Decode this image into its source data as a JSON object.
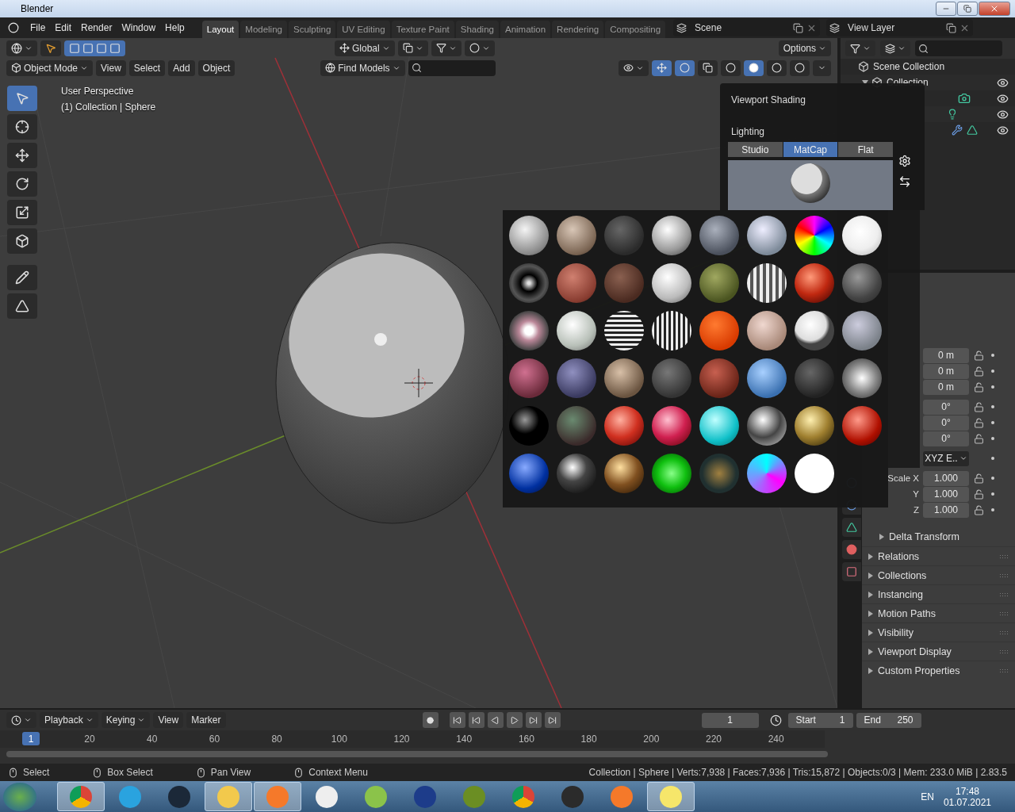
{
  "window": {
    "title": "Blender"
  },
  "menus": [
    "File",
    "Edit",
    "Render",
    "Window",
    "Help"
  ],
  "workspaces": [
    {
      "label": "Layout",
      "selected": true
    },
    {
      "label": "Modeling",
      "selected": false
    },
    {
      "label": "Sculpting",
      "selected": false
    },
    {
      "label": "UV Editing",
      "selected": false
    },
    {
      "label": "Texture Paint",
      "selected": false
    },
    {
      "label": "Shading",
      "selected": false
    },
    {
      "label": "Animation",
      "selected": false
    },
    {
      "label": "Rendering",
      "selected": false
    },
    {
      "label": "Compositing",
      "selected": false
    }
  ],
  "scene": {
    "name": "Scene"
  },
  "view_layer": {
    "name": "View Layer"
  },
  "viewport": {
    "orientation": "Global",
    "options": "Options",
    "mode": "Object Mode",
    "menus": [
      "View",
      "Select",
      "Add",
      "Object"
    ],
    "find": "Find Models",
    "info": [
      "User Perspective",
      "(1) Collection | Sphere"
    ],
    "shading_modes": [
      {
        "selected": false
      },
      {
        "selected": true
      },
      {
        "selected": false
      },
      {
        "selected": false
      }
    ]
  },
  "tools": [
    {
      "selected": true
    },
    {
      "selected": false
    },
    {
      "selected": false
    },
    {
      "selected": false
    },
    {
      "selected": false
    },
    {
      "selected": false
    },
    {
      "selected": false
    },
    {
      "selected": false
    }
  ],
  "shading_popover": {
    "title": "Viewport Shading",
    "lighting_label": "Lighting",
    "lighting": [
      {
        "label": "Studio",
        "selected": false
      },
      {
        "label": "MatCap",
        "selected": true
      },
      {
        "label": "Flat",
        "selected": false
      }
    ]
  },
  "outliner": {
    "root": "Scene Collection",
    "collection": {
      "name": "Collection",
      "expanded": true
    }
  },
  "properties": {
    "location": [
      "0 m",
      "0 m",
      "0 m"
    ],
    "rotation": [
      "0°",
      "0°",
      "0°"
    ],
    "mode": "XYZ E..",
    "scale": [
      {
        "label": "Scale X",
        "value": "1.000"
      },
      {
        "label": "Y",
        "value": "1.000"
      },
      {
        "label": "Z",
        "value": "1.000"
      }
    ],
    "subpanel": "Delta Transform",
    "panels": [
      "Relations",
      "Collections",
      "Instancing",
      "Motion Paths",
      "Visibility",
      "Viewport Display",
      "Custom Properties"
    ]
  },
  "timeline": {
    "menus": [
      "Playback",
      "Keying",
      "View",
      "Marker"
    ],
    "frame": "1",
    "start": {
      "label": "Start",
      "value": "1"
    },
    "end": {
      "label": "End",
      "value": "250"
    },
    "current": "1",
    "ticks": [
      "20",
      "40",
      "60",
      "80",
      "100",
      "120",
      "140",
      "160",
      "180",
      "200",
      "220",
      "240"
    ]
  },
  "status_bar": {
    "hints": [
      "Select",
      "Box Select",
      "Pan View",
      "Context Menu"
    ],
    "stats": "Collection | Sphere | Verts:7,938 | Faces:7,936 | Tris:15,872 | Objects:0/3 | Mem: 233.0 MiB | 2.83.5"
  },
  "taskbar": {
    "apps": [
      {
        "kind": "chrome",
        "active": true
      },
      {
        "kind": "telegram",
        "active": false
      },
      {
        "kind": "steam",
        "active": false
      },
      {
        "kind": "folder",
        "active": true
      },
      {
        "kind": "blender",
        "active": true
      },
      {
        "kind": "viewer",
        "active": false
      },
      {
        "kind": "lime",
        "active": false
      },
      {
        "kind": "editor",
        "active": false
      },
      {
        "kind": "block",
        "active": false
      },
      {
        "kind": "chrome",
        "active": false
      },
      {
        "kind": "arrow",
        "active": false
      },
      {
        "kind": "blender",
        "active": false
      },
      {
        "kind": "notes",
        "active": true
      }
    ],
    "language": "EN",
    "time": "17:48",
    "date": "01.07.2021"
  }
}
